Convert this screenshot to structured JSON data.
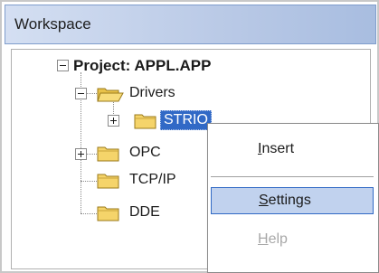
{
  "window": {
    "title": "Workspace"
  },
  "tree": {
    "project": {
      "label": "Project: APPL.APP",
      "expanded": true
    },
    "drivers": {
      "label": "Drivers",
      "expanded": true
    },
    "strio": {
      "label": "STRIO",
      "selected": true
    },
    "opc": {
      "label": "OPC"
    },
    "tcpip": {
      "label": "TCP/IP"
    },
    "dde": {
      "label": "DDE"
    },
    "icons": {
      "expanded": "minus-icon",
      "collapsed": "plus-icon",
      "folder": "folder-icon",
      "folder_open": "folder-open-icon"
    }
  },
  "context_menu": {
    "items": [
      {
        "first": "I",
        "rest": "nsert",
        "state": "normal"
      },
      {
        "first": "S",
        "rest": "ettings",
        "state": "highlighted"
      },
      {
        "first": "H",
        "rest": "elp",
        "state": "disabled"
      }
    ]
  },
  "colors": {
    "selection": "#3169c6",
    "menu_highlight": "#c1d2ee",
    "folder": "#f5d46a",
    "title_gradient": "#b9c9e6"
  }
}
